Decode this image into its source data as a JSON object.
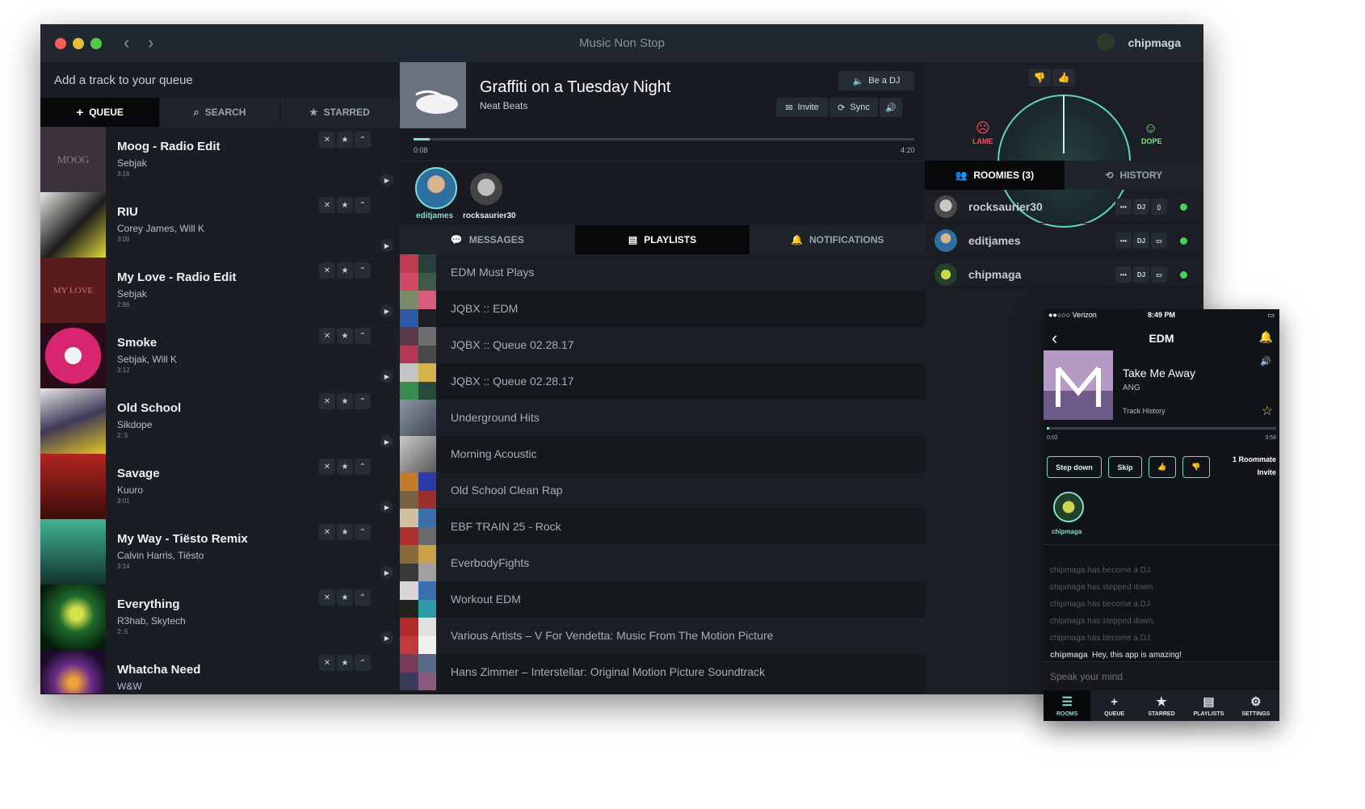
{
  "window": {
    "title": "Music Non Stop",
    "user": "chipmaga"
  },
  "colors": {
    "accent": "#7fe0cf",
    "lame": "#ff4b5c",
    "dope": "#7ee87a",
    "online": "#4bd05a"
  },
  "left": {
    "add_prompt": "Add a track to your queue",
    "tabs": [
      "QUEUE",
      "SEARCH",
      "STARRED"
    ],
    "tracks": [
      {
        "title": "Moog - Radio Edit",
        "artist": "Sebjak",
        "duration": "3:16"
      },
      {
        "title": "RIU",
        "artist": "Corey James, Will K",
        "duration": "3:09"
      },
      {
        "title": "My Love - Radio Edit",
        "artist": "Sebjak",
        "duration": "2:86"
      },
      {
        "title": "Smoke",
        "artist": "Sebjak, Will K",
        "duration": "3:12"
      },
      {
        "title": "Old School",
        "artist": "Sikdope",
        "duration": "2:.5"
      },
      {
        "title": "Savage",
        "artist": "Kuuro",
        "duration": "3:01"
      },
      {
        "title": "My Way - Tiësto Remix",
        "artist": "Calvin Harris, Tiësto",
        "duration": "3:14"
      },
      {
        "title": "Everything",
        "artist": "R3hab, Skytech",
        "duration": "2:.5"
      },
      {
        "title": "Whatcha Need",
        "artist": "W&W",
        "duration": ""
      }
    ],
    "track_art_text": [
      "MOOG",
      "",
      "MY LOVE",
      "",
      "",
      "",
      "",
      "",
      ""
    ]
  },
  "now_playing": {
    "title": "Graffiti on a Tuesday Night",
    "artist": "Neat Beats",
    "elapsed": "0:08",
    "total": "4:20",
    "progress": 0.032,
    "be_dj": "Be a DJ",
    "invite": "Invite",
    "sync": "Sync"
  },
  "djs": [
    "editjames",
    "rocksaurier30"
  ],
  "mid_tabs": [
    "MESSAGES",
    "PLAYLISTS",
    "NOTIFICATIONS"
  ],
  "playlists": [
    "EDM Must Plays",
    "JQBX :: EDM",
    "JQBX :: Queue 02.28.17",
    "JQBX :: Queue 02.28.17",
    "Underground Hits",
    "Morning Acoustic",
    "Old School Clean Rap",
    "EBF TRAIN 25 - Rock",
    "EverbodyFights",
    "Workout EDM",
    "Various Artists – V For Vendetta: Music From The Motion Picture",
    "Hans Zimmer – Interstellar: Original Motion Picture Soundtrack"
  ],
  "meter": {
    "lame": "LAME",
    "dope": "DOPE"
  },
  "right_tabs": [
    "ROOMIES (3)",
    "HISTORY"
  ],
  "roomies": [
    {
      "name": "rocksaurier30",
      "dj": "DJ"
    },
    {
      "name": "editjames",
      "dj": "DJ"
    },
    {
      "name": "chipmaga",
      "dj": "DJ"
    }
  ],
  "phone": {
    "carrier": "●●○○○ Verizon",
    "time": "8:49 PM",
    "title": "EDM",
    "track": "Take Me Away",
    "artist": "ANG",
    "history": "Track History",
    "elapsed": "0:02",
    "total": "3:58",
    "progress": 0.01,
    "buttons": [
      "Step down",
      "Skip"
    ],
    "roommates": "1 Roommate",
    "invite": "Invite",
    "dj": "chipmaga",
    "system_messages": [
      "chipmaga has become a DJ.",
      "chipmaga has stepped down.",
      "chipmaga has become a DJ.",
      "chipmaga has stepped down.",
      "chipmaga has become a DJ."
    ],
    "chat_user": "chipmaga",
    "chat_message": "Hey, this app is amazing!",
    "input_placeholder": "Speak your mind",
    "tabs": [
      "ROOMS",
      "QUEUE",
      "STARRED",
      "PLAYLISTS",
      "SETTINGS"
    ]
  }
}
